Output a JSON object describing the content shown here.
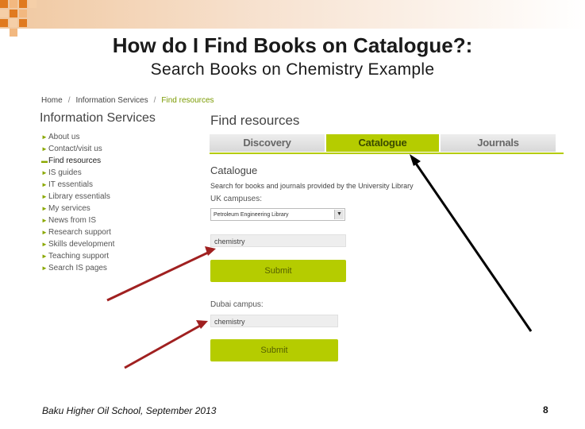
{
  "slide": {
    "title": "How do I Find Books on Catalogue?:",
    "subtitle": "Search Books on Chemistry Example",
    "footer": "Baku Higher Oil School, September 2013",
    "page_number": "8",
    "accent_color": "#e07a1f",
    "arrow_colors": {
      "black": "#000000",
      "red": "#a02020"
    }
  },
  "breadcrumb": [
    "Home",
    "Information Services",
    "Find resources"
  ],
  "sidebar": {
    "title": "Information Services",
    "items": [
      {
        "label": "About us",
        "active": false
      },
      {
        "label": "Contact/visit us",
        "active": false
      },
      {
        "label": "Find resources",
        "active": true
      },
      {
        "label": "IS guides",
        "active": false
      },
      {
        "label": "IT essentials",
        "active": false
      },
      {
        "label": "Library essentials",
        "active": false
      },
      {
        "label": "My services",
        "active": false
      },
      {
        "label": "News from IS",
        "active": false
      },
      {
        "label": "Research support",
        "active": false
      },
      {
        "label": "Skills development",
        "active": false
      },
      {
        "label": "Teaching support",
        "active": false
      },
      {
        "label": "Search IS pages",
        "active": false
      }
    ]
  },
  "main": {
    "title": "Find resources",
    "tabs": [
      {
        "label": "Discovery",
        "selected": false
      },
      {
        "label": "Catalogue",
        "selected": true
      },
      {
        "label": "Journals",
        "selected": false
      }
    ],
    "catalogue": {
      "heading": "Catalogue",
      "description": "Search for books and journals provided by the University Library",
      "uk_label": "UK campuses:",
      "uk_library_selected": "Petroleum Engineering Library",
      "uk_search_value": "chemistry",
      "uk_submit": "Submit",
      "dubai_label": "Dubai campus:",
      "dubai_search_value": "chemistry",
      "dubai_submit": "Submit"
    },
    "accent_color": "#b5cc00"
  }
}
